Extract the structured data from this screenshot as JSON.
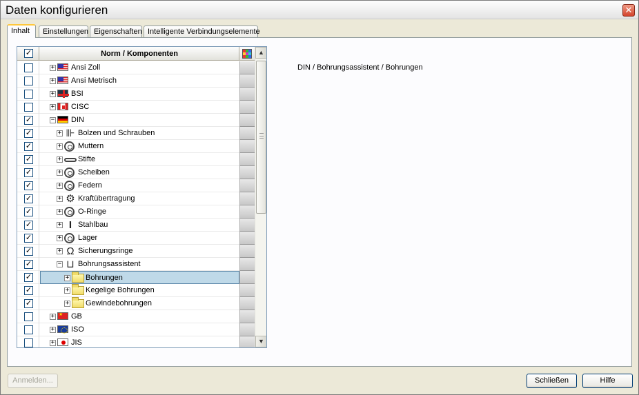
{
  "window": {
    "title": "Daten konfigurieren",
    "close_glyph": "✕"
  },
  "tabs": [
    {
      "label": "Inhalt",
      "active": true
    },
    {
      "label": "Einstellungen",
      "active": false
    },
    {
      "label": "Eigenschaften",
      "active": false
    },
    {
      "label": "Intelligente Verbindungselemente",
      "active": false
    }
  ],
  "tree": {
    "header_title": "Norm / Komponenten",
    "header_checked": true,
    "header_icon": "color-palette-icon",
    "rows": [
      {
        "label": "Ansi Zoll",
        "checked": false,
        "level": 0,
        "expander": "+",
        "icon": "flag-us"
      },
      {
        "label": "Ansi Metrisch",
        "checked": false,
        "level": 0,
        "expander": "+",
        "icon": "flag-us"
      },
      {
        "label": "BSI",
        "checked": false,
        "level": 0,
        "expander": "+",
        "icon": "flag-uk"
      },
      {
        "label": "CISC",
        "checked": false,
        "level": 0,
        "expander": "+",
        "icon": "flag-ca"
      },
      {
        "label": "DIN",
        "checked": true,
        "level": 0,
        "expander": "−",
        "icon": "flag-de"
      },
      {
        "label": "Bolzen und Schrauben",
        "checked": true,
        "level": 1,
        "expander": "+",
        "icon": "bolt"
      },
      {
        "label": "Muttern",
        "checked": true,
        "level": 1,
        "expander": "+",
        "icon": "ring"
      },
      {
        "label": "Stifte",
        "checked": true,
        "level": 1,
        "expander": "+",
        "icon": "pin"
      },
      {
        "label": "Scheiben",
        "checked": true,
        "level": 1,
        "expander": "+",
        "icon": "ring"
      },
      {
        "label": "Federn",
        "checked": true,
        "level": 1,
        "expander": "+",
        "icon": "ring"
      },
      {
        "label": "Kraftübertragung",
        "checked": true,
        "level": 1,
        "expander": "+",
        "icon": "gear"
      },
      {
        "label": "O-Ringe",
        "checked": true,
        "level": 1,
        "expander": "+",
        "icon": "ring"
      },
      {
        "label": "Stahlbau",
        "checked": true,
        "level": 1,
        "expander": "+",
        "icon": "ibeam"
      },
      {
        "label": "Lager",
        "checked": true,
        "level": 1,
        "expander": "+",
        "icon": "ring"
      },
      {
        "label": "Sicherungsringe",
        "checked": true,
        "level": 1,
        "expander": "+",
        "icon": "clip"
      },
      {
        "label": "Bohrungsassistent",
        "checked": true,
        "level": 1,
        "expander": "−",
        "icon": "hole"
      },
      {
        "label": "Bohrungen",
        "checked": true,
        "level": 2,
        "expander": "+",
        "icon": "folder",
        "selected": true
      },
      {
        "label": "Kegelige Bohrungen",
        "checked": true,
        "level": 2,
        "expander": "+",
        "icon": "folder"
      },
      {
        "label": "Gewindebohrungen",
        "checked": true,
        "level": 2,
        "expander": "+",
        "icon": "folder"
      },
      {
        "label": "GB",
        "checked": false,
        "level": 0,
        "expander": "+",
        "icon": "flag-cn"
      },
      {
        "label": "ISO",
        "checked": false,
        "level": 0,
        "expander": "+",
        "icon": "flag-eu"
      },
      {
        "label": "JIS",
        "checked": false,
        "level": 0,
        "expander": "+",
        "icon": "flag-jp"
      }
    ]
  },
  "scrollbar": {
    "up_glyph": "▲",
    "down_glyph": "▼"
  },
  "details": {
    "path": "DIN / Bohrungsassistent / Bohrungen"
  },
  "footer": {
    "anmelden_label": "Anmelden...",
    "schliessen_label": "Schließen",
    "hilfe_label": "Hilfe"
  },
  "colors": {
    "selection": "#bfd9e8",
    "tab_accent": "#ffc83c",
    "close_button": "#d2422c"
  }
}
